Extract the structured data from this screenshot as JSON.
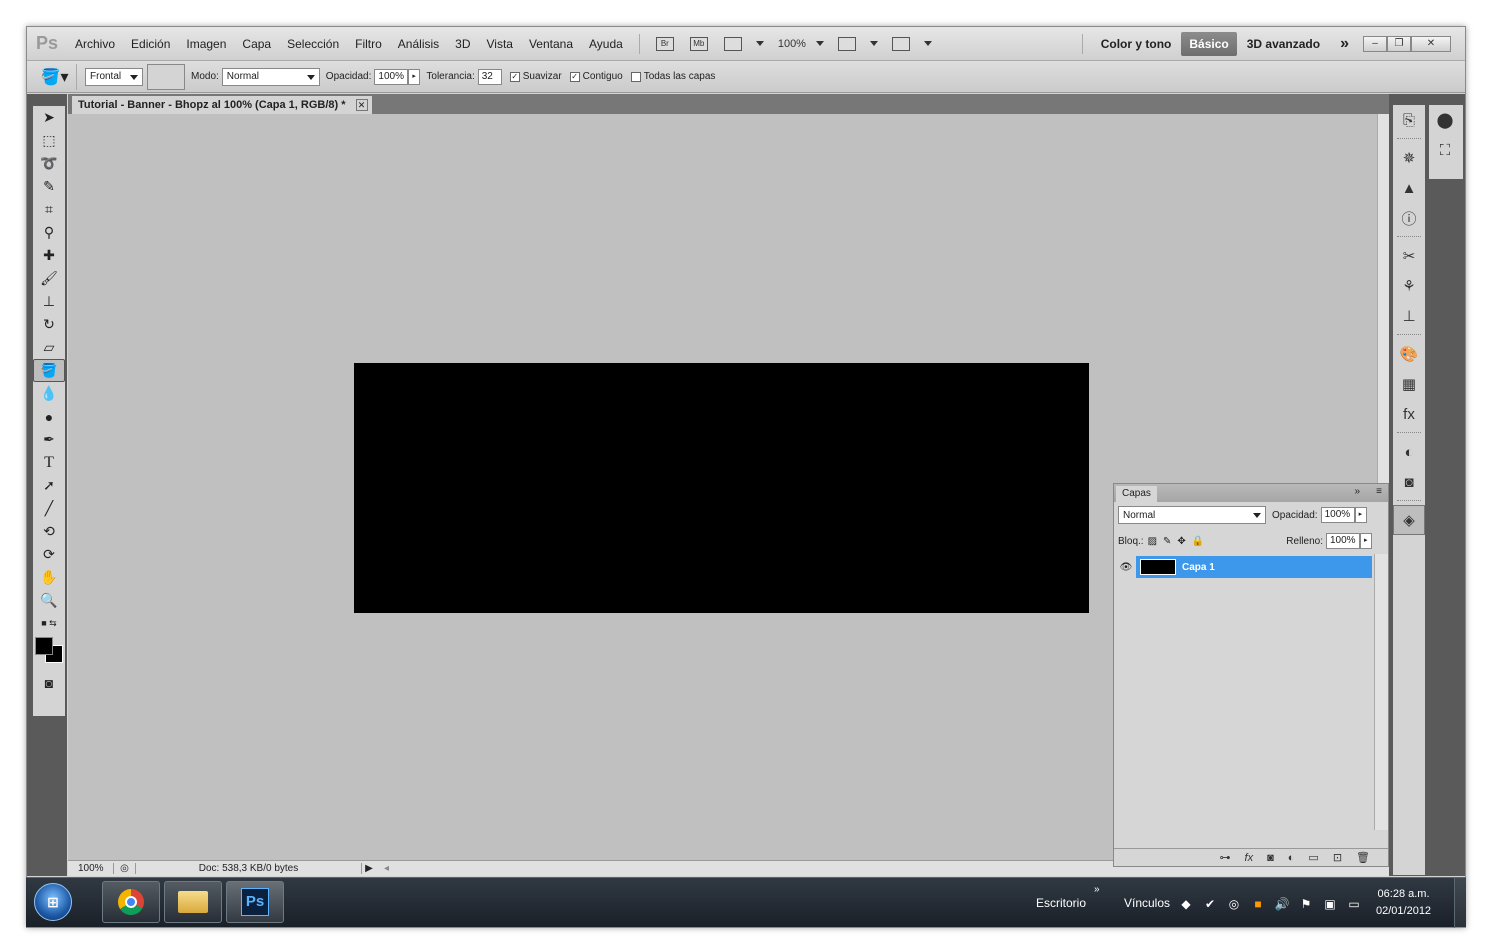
{
  "app": {
    "logo": "Ps",
    "menu": [
      "Archivo",
      "Edición",
      "Imagen",
      "Capa",
      "Selección",
      "Filtro",
      "Análisis",
      "3D",
      "Vista",
      "Ventana",
      "Ayuda"
    ],
    "bridge_label": "Br",
    "minibridge_label": "Mb",
    "zoom": "100%",
    "workspaces": [
      "Color y tono",
      "Básico",
      "3D avanzado"
    ],
    "more_workspaces": "»"
  },
  "options": {
    "fill_source": "Frontal",
    "mode_label": "Modo:",
    "mode_value": "Normal",
    "opacity_label": "Opacidad:",
    "opacity_value": "100%",
    "tolerance_label": "Tolerancia:",
    "tolerance_value": "32",
    "antialias_label": "Suavizar",
    "contiguous_label": "Contiguo",
    "all_layers_label": "Todas las capas"
  },
  "document": {
    "tab_title": "Tutorial - Banner - Bhopz al 100% (Capa 1, RGB/8) *",
    "status_zoom": "100%",
    "status_doc": "Doc: 538,3 KB/0 bytes"
  },
  "layers_panel": {
    "tab": "Capas",
    "blend_mode": "Normal",
    "opacity_label": "Opacidad:",
    "opacity_value": "100%",
    "lock_label": "Bloq.:",
    "fill_label": "Relleno:",
    "fill_value": "100%",
    "layers": [
      {
        "name": "Capa 1",
        "selected": true,
        "visible": true
      }
    ],
    "footer_icons": [
      "link-icon",
      "fx-icon",
      "mask-icon",
      "adjustment-icon",
      "folder-icon",
      "new-layer-icon",
      "trash-icon"
    ]
  },
  "taskbar": {
    "start_label": "⊞",
    "apps": [
      "chrome-icon",
      "explorer-icon",
      "photoshop-icon"
    ],
    "ps_label": "Ps",
    "toolbar_desktop": "Escritorio",
    "toolbar_links": "Vínculos",
    "time": "06:28 a.m.",
    "date": "02/01/2012"
  },
  "colors": {
    "selection_blue": "#3d98ec",
    "canvas_gray": "#c0c0c0",
    "document_black": "#000000"
  }
}
